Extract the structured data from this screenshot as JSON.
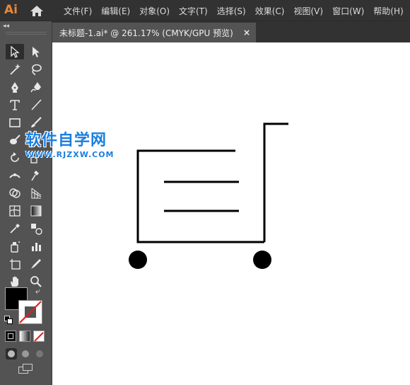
{
  "app": {
    "logo_text": "Ai",
    "accent_color": "#e8883a"
  },
  "menu": {
    "items": [
      {
        "label": "文件(F)"
      },
      {
        "label": "编辑(E)"
      },
      {
        "label": "对象(O)"
      },
      {
        "label": "文字(T)"
      },
      {
        "label": "选择(S)"
      },
      {
        "label": "效果(C)"
      },
      {
        "label": "视图(V)"
      },
      {
        "label": "窗口(W)"
      },
      {
        "label": "帮助(H)"
      }
    ]
  },
  "document": {
    "tab_title": "未标题-1.ai* @ 261.17% (CMYK/GPU 预览)",
    "close_label": "×"
  },
  "toolpanel": {
    "collapse_label": "◂◂",
    "tools": [
      "selection-tool-icon",
      "direct-selection-tool-icon",
      "magic-wand-tool-icon",
      "lasso-tool-icon",
      "pen-tool-icon",
      "curvature-tool-icon",
      "type-tool-icon",
      "line-segment-tool-icon",
      "rectangle-tool-icon",
      "paintbrush-tool-icon",
      "blob-brush-tool-icon",
      "eraser-tool-icon",
      "rotate-tool-icon",
      "scale-tool-icon",
      "width-tool-icon",
      "puppet-warp-tool-icon",
      "shape-builder-tool-icon",
      "perspective-grid-tool-icon",
      "mesh-tool-icon",
      "gradient-tool-icon",
      "eyedropper-tool-icon",
      "blend-tool-icon",
      "symbol-sprayer-tool-icon",
      "column-graph-tool-icon",
      "artboard-tool-icon",
      "slice-tool-icon",
      "hand-tool-icon",
      "zoom-tool-icon"
    ],
    "fill_color": "#000000",
    "stroke_color": "none"
  },
  "watermark": {
    "cn": "软件自学网",
    "en": "WWW.RJZXW.COM",
    "color": "#1b7fe0"
  }
}
